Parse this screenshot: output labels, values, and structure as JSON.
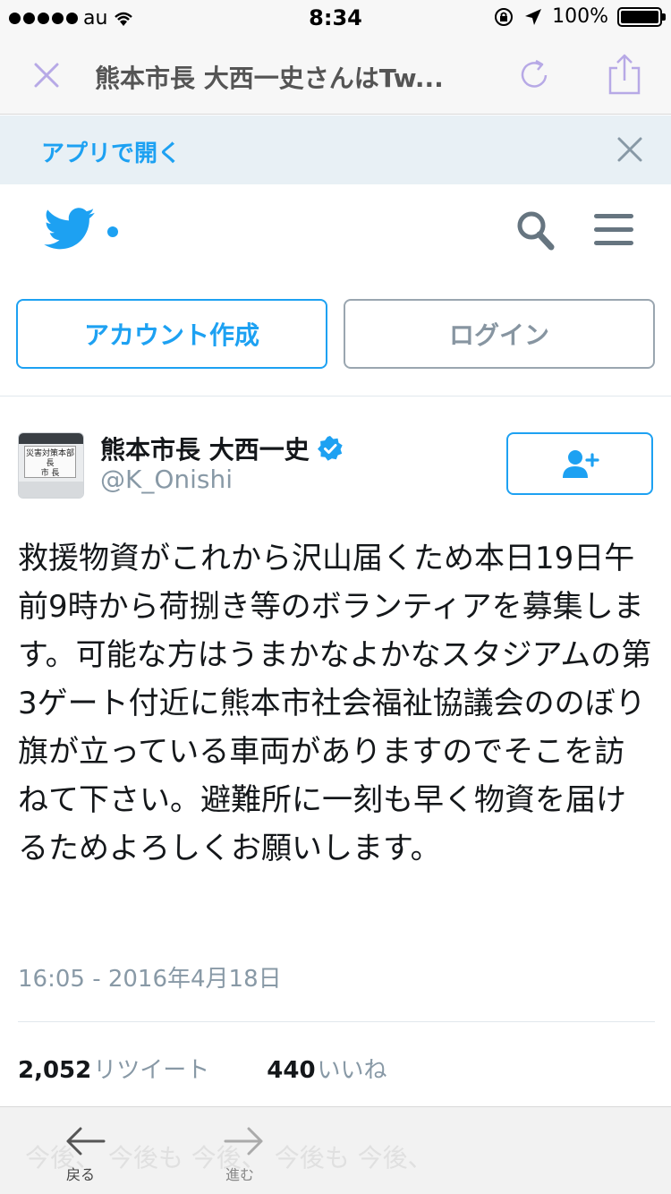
{
  "status_bar": {
    "carrier": "au",
    "time": "8:34",
    "battery": "100%",
    "battery_level": 1.0,
    "icons": [
      "signal-dots-icon",
      "wifi-icon",
      "orientation-lock-icon",
      "location-arrow-icon",
      "battery-icon"
    ]
  },
  "browser": {
    "title": "熊本市長 大西一史さんはTw...",
    "icons": [
      "close-icon",
      "reload-icon",
      "share-icon"
    ]
  },
  "app_banner": {
    "open_app_label": "アプリで開く"
  },
  "header": {
    "icons": [
      "twitter-bird-icon",
      "search-icon",
      "menu-icon"
    ]
  },
  "buttons": {
    "signup_label": "アカウント作成",
    "login_label": "ログイン"
  },
  "tweet": {
    "avatar_text": "災害対策本部長\n市 長",
    "display_name": "熊本市長 大西一史",
    "handle": "@K_Onishi",
    "text": "救援物資がこれから沢山届くため本日19日午前9時から荷捌き等のボランティアを募集します。可能な方はうまかなよかなスタジアムの第3ゲート付近に熊本市社会福祉協議会ののぼり旗が立っている車両がありますのでそこを訪ねて下さい。避難所に一刻も早く物資を届けるためよろしくお願いします。",
    "timestamp": "16:05 - 2016年4月18日",
    "retweets": {
      "count": "2,052",
      "label": "リツイート"
    },
    "likes": {
      "count": "440",
      "label": "いいね"
    }
  },
  "toolbar": {
    "back_label": "戻る",
    "forward_label": "進む",
    "ghost_text": "今後、 今後も 今後、 今後も 今後、"
  },
  "colors": {
    "twitter_blue": "#1da1f2",
    "gray_text": "#8899a6",
    "browser_accent": "#b7a9e6"
  }
}
